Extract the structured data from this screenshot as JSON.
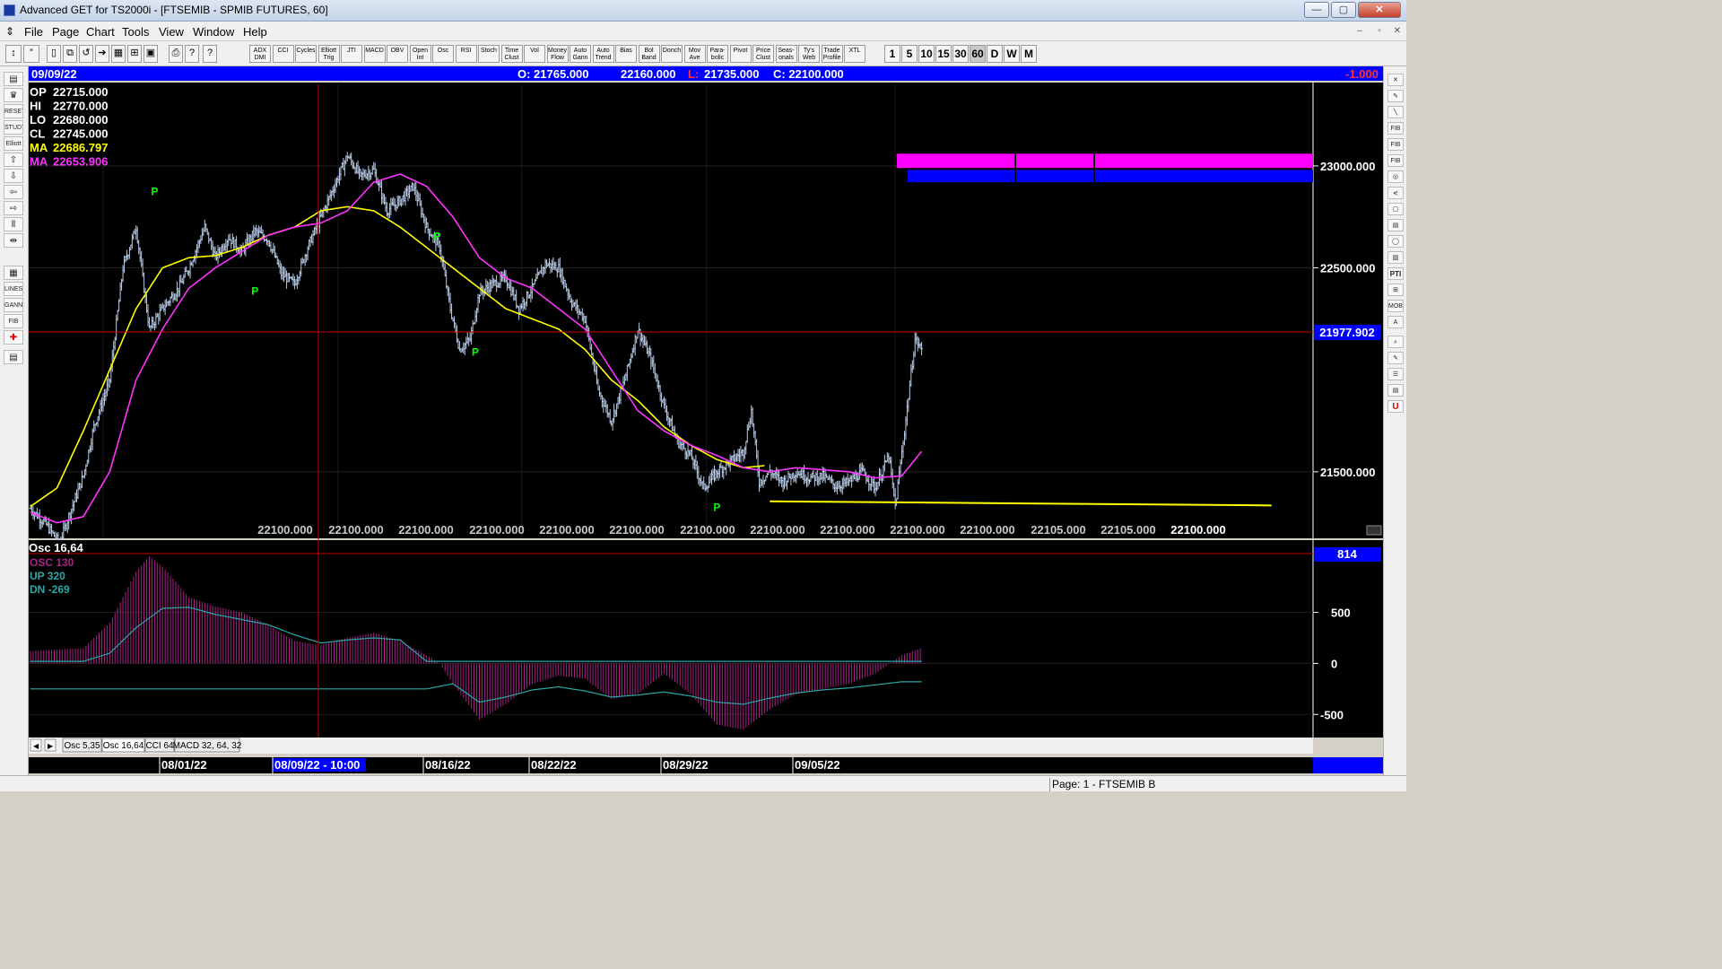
{
  "window": {
    "title": "Advanced GET for TS2000i - [FTSEMIB - SPMIB FUTURES, 60]",
    "min_label": "—",
    "max_label": "▢",
    "close_label": "✕"
  },
  "menu": [
    "File",
    "Page",
    "Chart",
    "Tools",
    "View",
    "Window",
    "Help"
  ],
  "toolbar": {
    "studies": [
      "ADX DMI",
      "CCI",
      "Cycles",
      "Elliott Trig",
      "JTI",
      "MACD",
      "OBV",
      "Open Int",
      "Osc",
      "RSI",
      "Stoch",
      "Time Clust",
      "Vol",
      "Money Flow",
      "Auto Gann",
      "Auto Trend",
      "Bias",
      "Bol Band",
      "Donch",
      "Mov Ave",
      "Para-bolic",
      "Pivot",
      "Price Clust",
      "Seas-onals",
      "Ty's Web",
      "Trade Profile",
      "XTL"
    ],
    "intervals": [
      "1",
      "5",
      "10",
      "15",
      "30",
      "60",
      "D",
      "W",
      "M"
    ],
    "selected_interval": "60"
  },
  "header": {
    "date": "09/09/22",
    "open": "O: 21765.000",
    "high": "22160.000",
    "low_prefix": "L:",
    "low": "21735.000",
    "close": "C: 22100.000",
    "change": "-1.000"
  },
  "info": [
    {
      "label": "OP",
      "value": "22715.000",
      "color": "#ffffff"
    },
    {
      "label": "HI",
      "value": "22770.000",
      "color": "#ffffff"
    },
    {
      "label": "LO",
      "value": "22680.000",
      "color": "#ffffff"
    },
    {
      "label": "CL",
      "value": "22745.000",
      "color": "#ffffff"
    },
    {
      "label": "MA",
      "value": "22686.797",
      "color": "#ffff00"
    },
    {
      "label": "MA",
      "value": "22653.906",
      "color": "#ff33ff"
    }
  ],
  "price_axis": {
    "ticks": [
      "23000.000",
      "22500.000",
      "21500.000"
    ],
    "current_price": "21977.902"
  },
  "bottom_price_labels": [
    "22100.000",
    "22100.000",
    "22100.000",
    "22100.000",
    "22100.000",
    "22100.000",
    "22100.000",
    "22100.000",
    "22100.000",
    "22100.000",
    "22100.000",
    "22105.000",
    "22105.000",
    "22100.000"
  ],
  "pivot_marker": "P",
  "oscillator": {
    "title": "Osc 16,64",
    "osc_label": "OSC 130",
    "up_label": "UP 320",
    "dn_label": "DN -269",
    "current": "814",
    "ticks": [
      "500",
      "0",
      "-500"
    ]
  },
  "tabs": [
    "Osc 5,35",
    "Osc 16,64",
    "CCI 64",
    "MACD 32, 64, 32"
  ],
  "active_tab": "Osc 16,64",
  "date_axis": {
    "labels": [
      "08/01/22",
      "08/09/22 - 10:00",
      "08/16/22",
      "08/22/22",
      "08/29/22",
      "09/05/22"
    ],
    "cursor_index": 1
  },
  "status": {
    "page": "Page: 1 - FTSEMIB B"
  },
  "colors": {
    "background": "#000000",
    "bars": "#b8cce8",
    "ma_fast": "#ffff00",
    "ma_slow": "#ff33ff",
    "pivot": "#00ff00",
    "header_bar": "#0000ff",
    "cursor": "#cc0000",
    "osc_hist": "#aa2288",
    "osc_band": "#2aa8a8"
  },
  "chart_data": [
    {
      "type": "ohlc",
      "title": "FTSEMIB - SPMIB FUTURES, 60",
      "ylim": [
        21200,
        23400
      ],
      "price_anchors": [
        [
          0,
          21320
        ],
        [
          12,
          21240
        ],
        [
          22,
          21150
        ],
        [
          30,
          21300
        ],
        [
          40,
          21480
        ],
        [
          48,
          21720
        ],
        [
          60,
          21950
        ],
        [
          70,
          22500
        ],
        [
          80,
          22700
        ],
        [
          90,
          22200
        ],
        [
          100,
          22300
        ],
        [
          112,
          22400
        ],
        [
          120,
          22500
        ],
        [
          132,
          22700
        ],
        [
          140,
          22550
        ],
        [
          150,
          22650
        ],
        [
          160,
          22580
        ],
        [
          170,
          22680
        ],
        [
          180,
          22640
        ],
        [
          190,
          22470
        ],
        [
          200,
          22420
        ],
        [
          210,
          22600
        ],
        [
          220,
          22750
        ],
        [
          230,
          22900
        ],
        [
          240,
          23050
        ],
        [
          250,
          22950
        ],
        [
          260,
          22980
        ],
        [
          270,
          22780
        ],
        [
          280,
          22830
        ],
        [
          290,
          22900
        ],
        [
          300,
          22700
        ],
        [
          310,
          22600
        ],
        [
          318,
          22300
        ],
        [
          325,
          22100
        ],
        [
          333,
          22150
        ],
        [
          340,
          22380
        ],
        [
          350,
          22420
        ],
        [
          360,
          22450
        ],
        [
          370,
          22300
        ],
        [
          380,
          22400
        ],
        [
          390,
          22520
        ],
        [
          400,
          22500
        ],
        [
          410,
          22330
        ],
        [
          420,
          22250
        ],
        [
          430,
          21900
        ],
        [
          440,
          21750
        ],
        [
          450,
          21950
        ],
        [
          460,
          22200
        ],
        [
          470,
          22050
        ],
        [
          480,
          21820
        ],
        [
          490,
          21650
        ],
        [
          500,
          21580
        ],
        [
          510,
          21420
        ],
        [
          520,
          21500
        ],
        [
          530,
          21550
        ],
        [
          540,
          21600
        ],
        [
          546,
          21800
        ],
        [
          552,
          21450
        ],
        [
          560,
          21500
        ],
        [
          570,
          21450
        ],
        [
          580,
          21500
        ],
        [
          590,
          21470
        ],
        [
          600,
          21480
        ],
        [
          610,
          21430
        ],
        [
          620,
          21450
        ],
        [
          630,
          21500
        ],
        [
          640,
          21420
        ],
        [
          650,
          21580
        ],
        [
          655,
          21330
        ],
        [
          662,
          21700
        ],
        [
          670,
          22150
        ],
        [
          675,
          22100
        ]
      ],
      "ma_fast_anchors": [
        [
          0,
          21330
        ],
        [
          20,
          21420
        ],
        [
          40,
          21700
        ],
        [
          60,
          22000
        ],
        [
          80,
          22300
        ],
        [
          100,
          22500
        ],
        [
          120,
          22550
        ],
        [
          140,
          22560
        ],
        [
          160,
          22600
        ],
        [
          180,
          22660
        ],
        [
          200,
          22700
        ],
        [
          220,
          22780
        ],
        [
          240,
          22800
        ],
        [
          260,
          22780
        ],
        [
          280,
          22700
        ],
        [
          300,
          22600
        ],
        [
          320,
          22500
        ],
        [
          340,
          22400
        ],
        [
          360,
          22300
        ],
        [
          380,
          22250
        ],
        [
          400,
          22200
        ],
        [
          420,
          22100
        ],
        [
          440,
          21950
        ],
        [
          460,
          21850
        ],
        [
          480,
          21720
        ],
        [
          500,
          21630
        ],
        [
          520,
          21560
        ],
        [
          540,
          21520
        ],
        [
          556,
          21530
        ]
      ],
      "ma_slow_anchors": [
        [
          0,
          21300
        ],
        [
          20,
          21250
        ],
        [
          40,
          21280
        ],
        [
          60,
          21500
        ],
        [
          80,
          21950
        ],
        [
          100,
          22200
        ],
        [
          120,
          22400
        ],
        [
          140,
          22500
        ],
        [
          160,
          22580
        ],
        [
          180,
          22660
        ],
        [
          200,
          22700
        ],
        [
          220,
          22720
        ],
        [
          240,
          22780
        ],
        [
          260,
          22920
        ],
        [
          280,
          22960
        ],
        [
          300,
          22900
        ],
        [
          320,
          22750
        ],
        [
          340,
          22550
        ],
        [
          360,
          22450
        ],
        [
          380,
          22400
        ],
        [
          400,
          22300
        ],
        [
          420,
          22200
        ],
        [
          440,
          22000
        ],
        [
          460,
          21800
        ],
        [
          480,
          21700
        ],
        [
          500,
          21630
        ],
        [
          520,
          21580
        ],
        [
          540,
          21520
        ],
        [
          560,
          21500
        ],
        [
          580,
          21520
        ],
        [
          600,
          21510
        ],
        [
          620,
          21500
        ],
        [
          640,
          21470
        ],
        [
          660,
          21480
        ],
        [
          675,
          21600
        ]
      ],
      "trend_line": {
        "x0": 560,
        "y0": 21355,
        "x1": 940,
        "y1": 21335
      },
      "pivots": [
        {
          "i": 94,
          "price": 22840,
          "pos": "above"
        },
        {
          "i": 170,
          "price": 22430,
          "pos": "below"
        },
        {
          "i": 308,
          "price": 22620,
          "pos": "above"
        },
        {
          "i": 337,
          "price": 22130,
          "pos": "below"
        },
        {
          "i": 520,
          "price": 21370,
          "pos": "below"
        }
      ],
      "projection_boxes": {
        "magenta": {
          "y_top": 23060,
          "y_bot": 22990
        },
        "blue": {
          "y_top": 22980,
          "y_bot": 22920
        },
        "splits_at_bars": [
          620,
          660
        ]
      }
    },
    {
      "type": "histogram",
      "title": "Osc 16,64",
      "ylim": [
        -700,
        1050
      ],
      "hist_anchors": [
        [
          0,
          120
        ],
        [
          40,
          150
        ],
        [
          60,
          400
        ],
        [
          80,
          900
        ],
        [
          90,
          1050
        ],
        [
          100,
          950
        ],
        [
          120,
          650
        ],
        [
          140,
          560
        ],
        [
          160,
          500
        ],
        [
          180,
          380
        ],
        [
          200,
          220
        ],
        [
          220,
          180
        ],
        [
          240,
          250
        ],
        [
          260,
          300
        ],
        [
          280,
          220
        ],
        [
          300,
          80
        ],
        [
          310,
          0
        ],
        [
          320,
          -200
        ],
        [
          340,
          -550
        ],
        [
          360,
          -400
        ],
        [
          380,
          -200
        ],
        [
          400,
          -120
        ],
        [
          420,
          -150
        ],
        [
          440,
          -350
        ],
        [
          460,
          -300
        ],
        [
          480,
          -100
        ],
        [
          500,
          -300
        ],
        [
          520,
          -600
        ],
        [
          540,
          -650
        ],
        [
          560,
          -450
        ],
        [
          580,
          -300
        ],
        [
          600,
          -250
        ],
        [
          620,
          -200
        ],
        [
          640,
          -100
        ],
        [
          660,
          80
        ],
        [
          675,
          150
        ]
      ],
      "up_band_anchors": [
        [
          0,
          20
        ],
        [
          40,
          20
        ],
        [
          60,
          100
        ],
        [
          80,
          350
        ],
        [
          100,
          540
        ],
        [
          120,
          550
        ],
        [
          140,
          480
        ],
        [
          160,
          430
        ],
        [
          180,
          380
        ],
        [
          200,
          280
        ],
        [
          220,
          200
        ],
        [
          240,
          230
        ],
        [
          260,
          250
        ],
        [
          280,
          230
        ],
        [
          300,
          20
        ],
        [
          675,
          20
        ]
      ],
      "dn_band_anchors": [
        [
          0,
          -250
        ],
        [
          300,
          -250
        ],
        [
          320,
          -200
        ],
        [
          340,
          -380
        ],
        [
          360,
          -330
        ],
        [
          380,
          -260
        ],
        [
          400,
          -230
        ],
        [
          420,
          -270
        ],
        [
          440,
          -330
        ],
        [
          460,
          -310
        ],
        [
          480,
          -280
        ],
        [
          500,
          -320
        ],
        [
          520,
          -380
        ],
        [
          540,
          -400
        ],
        [
          560,
          -340
        ],
        [
          580,
          -290
        ],
        [
          600,
          -260
        ],
        [
          620,
          -240
        ],
        [
          640,
          -210
        ],
        [
          660,
          -180
        ],
        [
          675,
          -180
        ]
      ]
    }
  ]
}
